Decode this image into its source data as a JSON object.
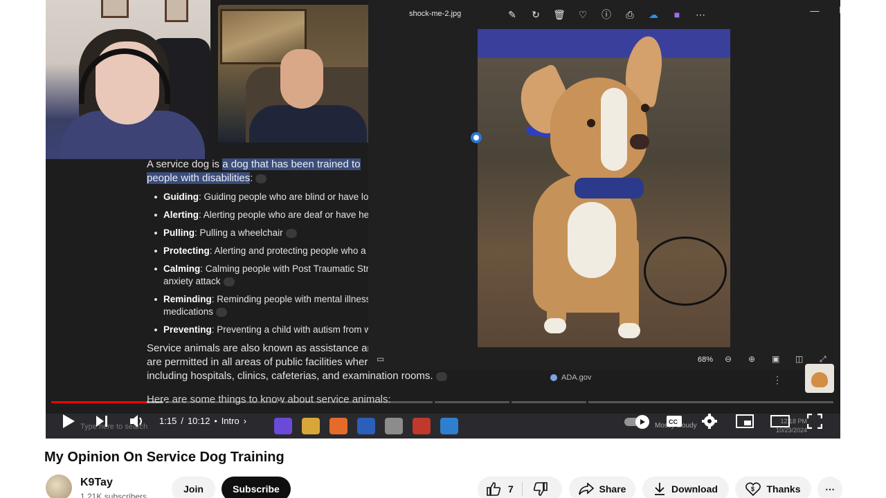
{
  "document": {
    "intro_plain": "A service dog is ",
    "intro_highlight_1": "a dog that has been trained to",
    "intro_highlight_2": "people with disabilities",
    "intro_colon": ":",
    "items": [
      {
        "term": "Guiding",
        "text": ": Guiding people who are blind or have lo"
      },
      {
        "term": "Alerting",
        "text": ": Alerting people who are deaf or have he"
      },
      {
        "term": "Pulling",
        "text": ": Pulling a wheelchair"
      },
      {
        "term": "Protecting",
        "text": ": Alerting and protecting people who a"
      },
      {
        "term": "Calming",
        "text": ": Calming people with Post Traumatic Str",
        "cont": "anxiety attack"
      },
      {
        "term": "Reminding",
        "text": ": Reminding people with mental illness",
        "cont": "medications"
      },
      {
        "term": "Preventing",
        "text": ": Preventing a child with autism from w"
      }
    ],
    "para_line1": "Service animals are also known as assistance ar",
    "para_line2": "are permitted in all areas of public facilities where the public is allowed to go,",
    "para_line3": "including hospitals, clinics, cafeterias, and examination rooms.",
    "para2": "Here are some things to know about service animals:"
  },
  "viewer": {
    "filename": "shock-me-2.jpg",
    "zoom": "68%",
    "source": "ADA.gov"
  },
  "taskbar": {
    "search_placeholder": "Type here to search",
    "weather": "Mostly cloudy",
    "time": "12:18 PM",
    "date": "10/23/2024"
  },
  "player": {
    "current_time": "1:15",
    "separator": "/",
    "duration": "10:12",
    "chapter": "Intro",
    "chapter_sep": "•",
    "played_fraction": 0.1225,
    "buffered_fraction": 0.146,
    "accent_color": "#ff0000"
  },
  "video": {
    "title": "My Opinion On Service Dog Training",
    "channel_name": "K9Tay",
    "subscribers": "1.21K subscribers",
    "join_label": "Join",
    "subscribe_label": "Subscribe",
    "like_count": "7",
    "share_label": "Share",
    "download_label": "Download",
    "thanks_label": "Thanks"
  }
}
